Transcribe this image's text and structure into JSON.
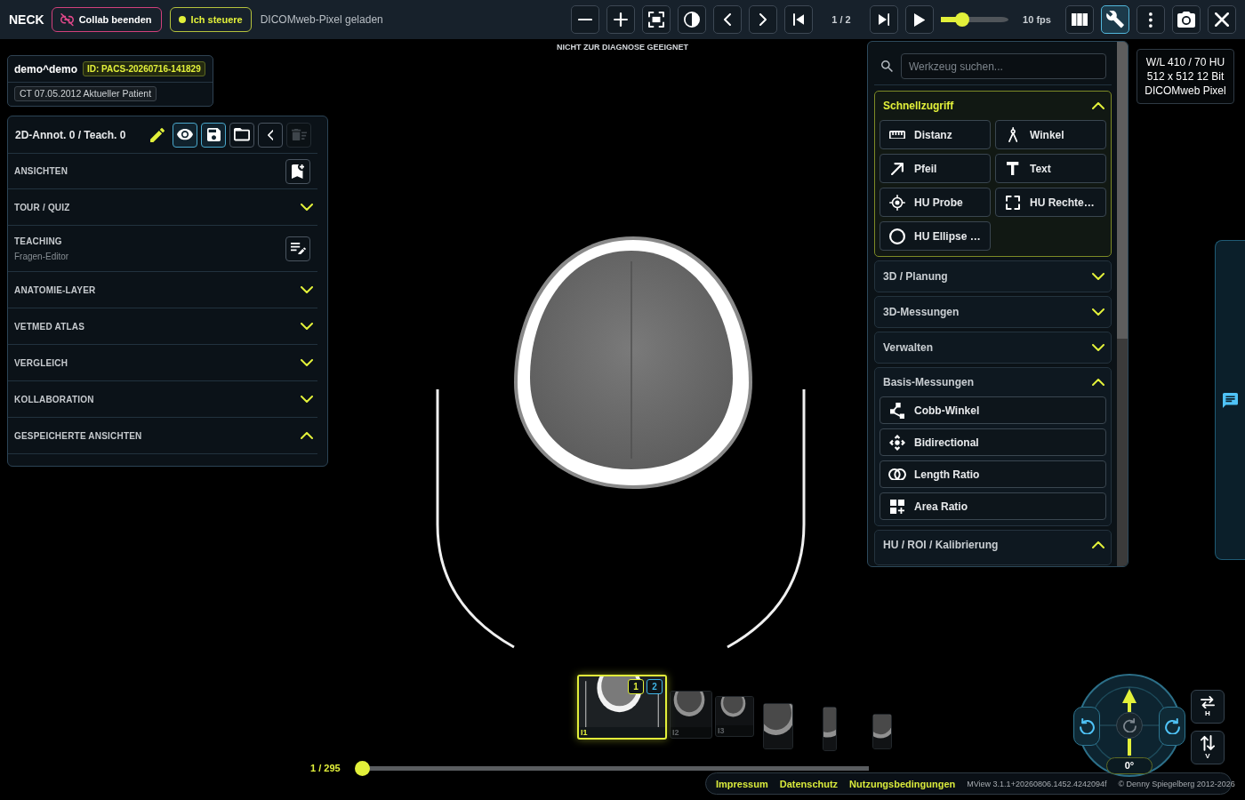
{
  "top_bar": {
    "title": "NECK",
    "collab_button": {
      "label": "Collab beenden"
    },
    "control_status": {
      "label": "Ich steuere"
    },
    "load_status": "DICOMweb-Pixel geladen",
    "toolbar": [
      {
        "kind": "button",
        "selected": false
      },
      {
        "kind": "button",
        "selected": false
      },
      {
        "kind": "button",
        "selected": false
      },
      {
        "kind": "button",
        "selected": false
      },
      {
        "kind": "button",
        "selected": false
      },
      {
        "kind": "button",
        "selected": false
      },
      {
        "kind": "button",
        "selected": false
      },
      {
        "kind": "text",
        "text": "1 / 2"
      },
      {
        "kind": "button",
        "selected": false
      },
      {
        "kind": "button",
        "selected": false
      },
      {
        "kind": "slider",
        "level": 0.32
      },
      {
        "kind": "text",
        "text": "10 fps"
      },
      {
        "kind": "button",
        "selected": false
      },
      {
        "kind": "button",
        "selected": true
      },
      {
        "kind": "button",
        "selected": false
      },
      {
        "kind": "button",
        "selected": false
      },
      {
        "kind": "button",
        "selected": false
      }
    ]
  },
  "banner": "NICHT ZUR DIAGNOSE GEEIGNET",
  "patient_card": {
    "name": "demo^demo",
    "id": "ID: PACS-20260716-141829",
    "study": "CT 07.05.2012 Aktueller Patient"
  },
  "annotation_panel": {
    "title": "2D-Annot. 0 / Teach. 0",
    "actions": [
      {
        "active": true,
        "disabled": false
      },
      {
        "active": true,
        "disabled": false
      },
      {
        "active": false,
        "disabled": false
      },
      {
        "active": false,
        "disabled": false
      },
      {
        "active": false,
        "disabled": true
      }
    ],
    "sections": [
      {
        "kind": "action",
        "label": "ANSICHTEN"
      },
      {
        "kind": "accordion",
        "label": "TOUR / QUIZ",
        "expanded": false
      },
      {
        "kind": "action",
        "label": "TEACHING",
        "subtitle": "Fragen-Editor"
      },
      {
        "kind": "accordion",
        "label": "ANATOMIE-LAYER",
        "expanded": false
      },
      {
        "kind": "accordion",
        "label": "VETMED ATLAS",
        "expanded": false
      },
      {
        "kind": "accordion",
        "label": "VERGLEICH",
        "expanded": false
      },
      {
        "kind": "accordion",
        "label": "KOLLABORATION",
        "expanded": false
      },
      {
        "kind": "accordion",
        "label": "GESPEICHERTE ANSICHTEN",
        "expanded": true
      }
    ]
  },
  "tool_panel": {
    "search": {
      "placeholder": "Werkzeug suchen..."
    },
    "groups": [
      {
        "kind": "grid",
        "title": "Schnellzugriff",
        "highlighted": true,
        "expanded": true,
        "tools": [
          "Distanz",
          "Winkel",
          "Pfeil",
          "Text",
          "HU Probe",
          "HU Rechte…",
          "HU Ellipse …"
        ]
      },
      {
        "title": "3D / Planung",
        "highlighted": false,
        "expanded": false
      },
      {
        "title": "3D-Messungen",
        "highlighted": false,
        "expanded": false
      },
      {
        "title": "Verwalten",
        "highlighted": false,
        "expanded": false
      },
      {
        "kind": "list",
        "title": "Basis-Messungen",
        "highlighted": false,
        "expanded": true,
        "tools": [
          "Cobb-Winkel",
          "Bidirectional",
          "Length Ratio",
          "Area Ratio"
        ]
      },
      {
        "title": "HU / ROI / Kalibrierung",
        "highlighted": false,
        "expanded": true
      }
    ]
  },
  "image_info": [
    "W/L 410 / 70 HU",
    "512 x 512 12 Bit",
    "DICOMweb Pixel"
  ],
  "thumbnails": [
    {
      "label": "I1",
      "selected": true,
      "badges": [
        {
          "text": "1",
          "color": "#e2f03a"
        },
        {
          "text": "2",
          "color": "#3fb6e8"
        }
      ]
    },
    {
      "label": "I2",
      "selected": false
    },
    {
      "label": "I3",
      "selected": false
    },
    {
      "selected": false
    },
    {
      "selected": false
    },
    {
      "selected": false
    }
  ],
  "slice_slider": {
    "counter": "1 / 295",
    "level": 0
  },
  "footer": {
    "links": [
      "Impressum",
      "Datenschutz",
      "Nutzungsbedingungen"
    ],
    "version": "MView 3.1.1+20260806.1452.4242094f",
    "copyright": "© Denny Spiegelberg 2012-2026"
  },
  "orientation": {
    "angle": "0°",
    "flips": [
      "H",
      "V"
    ]
  }
}
